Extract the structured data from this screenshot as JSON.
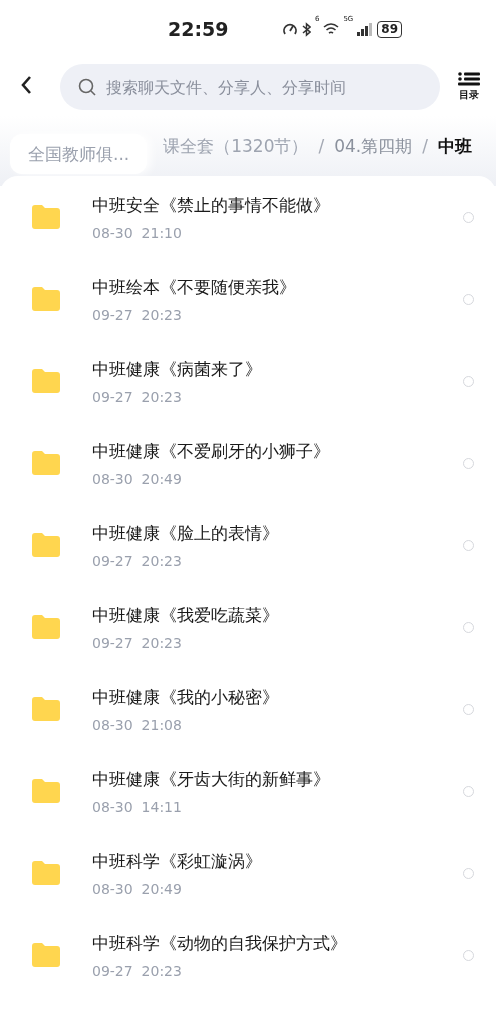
{
  "status_bar": {
    "time": "22:59",
    "wifi_badge": "6",
    "network": "5G",
    "battery": "89"
  },
  "top_bar": {
    "search": {
      "placeholder": "搜索聊天文件、分享人、分享时间"
    },
    "menu_label": "目录"
  },
  "breadcrumb": [
    {
      "label": "全国教师俱...",
      "kind": "chip"
    },
    {
      "label": "课全套（1320节）",
      "kind": "crumb"
    },
    {
      "label": "/",
      "kind": "separator"
    },
    {
      "label": "04.第四期",
      "kind": "crumb"
    },
    {
      "label": "/",
      "kind": "separator"
    },
    {
      "label": "中班",
      "kind": "current"
    }
  ],
  "files": [
    {
      "name": "中班安全《禁止的事情不能做》",
      "date": "08-30  21:10",
      "selected": false
    },
    {
      "name": "中班绘本《不要随便亲我》",
      "date": "09-27  20:23",
      "selected": false
    },
    {
      "name": "中班健康《病菌来了》",
      "date": "09-27  20:23",
      "selected": false
    },
    {
      "name": "中班健康《不爱刷牙的小狮子》",
      "date": "08-30  20:49",
      "selected": false
    },
    {
      "name": "中班健康《脸上的表情》",
      "date": "09-27  20:23",
      "selected": false
    },
    {
      "name": "中班健康《我爱吃蔬菜》",
      "date": "09-27  20:23",
      "selected": false
    },
    {
      "name": "中班健康《我的小秘密》",
      "date": "08-30  21:08",
      "selected": false
    },
    {
      "name": "中班健康《牙齿大街的新鲜事》",
      "date": "08-30  14:11",
      "selected": false
    },
    {
      "name": "中班科学《彩虹漩涡》",
      "date": "08-30  20:49",
      "selected": false
    },
    {
      "name": "中班科学《动物的自我保护方式》",
      "date": "09-27  20:23",
      "selected": false
    }
  ]
}
